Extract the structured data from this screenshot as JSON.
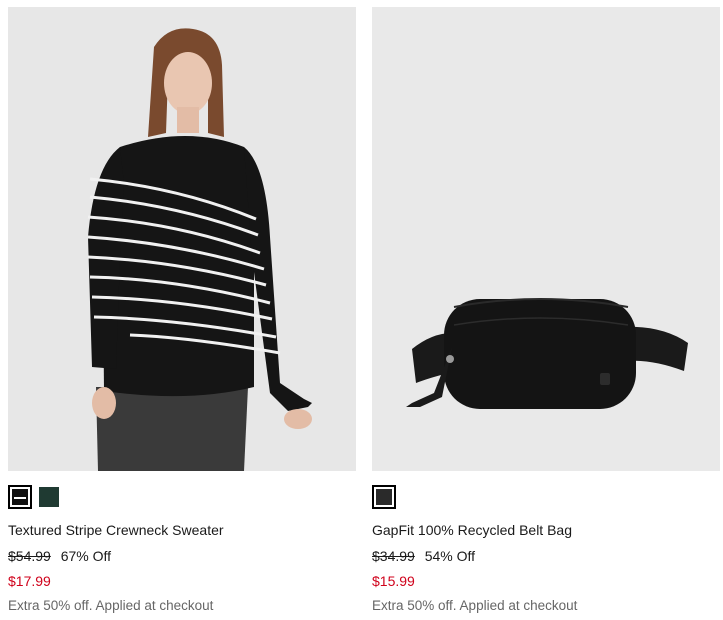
{
  "products": [
    {
      "name": "Textured Stripe Crewneck Sweater",
      "original_price": "$54.99",
      "discount": "67% Off",
      "sale_price": "$17.99",
      "promo": "Extra 50% off. Applied at checkout",
      "swatches": [
        {
          "color": "#111111",
          "accent": "#ffffff",
          "selected": true
        },
        {
          "color": "#1f3a32",
          "selected": false
        }
      ]
    },
    {
      "name": "GapFit 100% Recycled Belt Bag",
      "original_price": "$34.99",
      "discount": "54% Off",
      "sale_price": "$15.99",
      "promo": "Extra 50% off. Applied at checkout",
      "swatches": [
        {
          "color": "#2a2a2a",
          "selected": true
        }
      ]
    }
  ],
  "colors": {
    "sale": "#d0021b",
    "promo": "#666666",
    "image_bg": "#e6e6e6"
  }
}
